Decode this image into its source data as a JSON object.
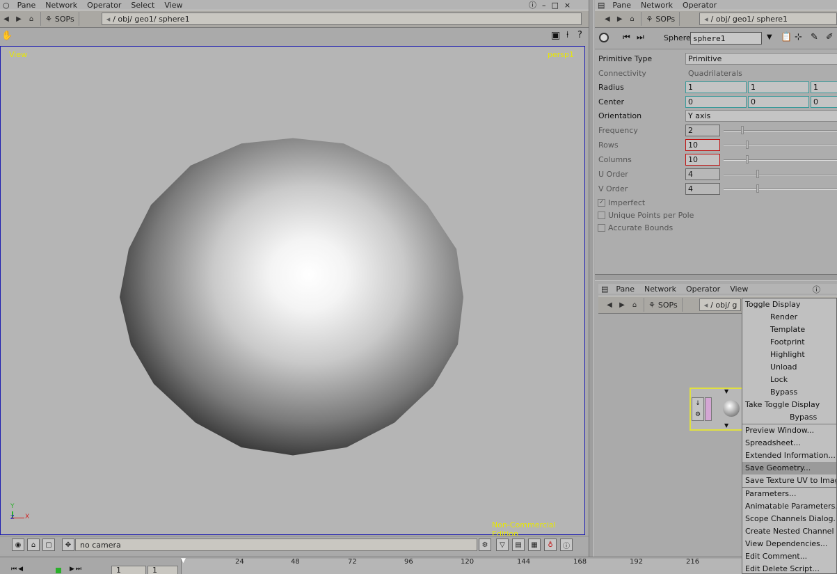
{
  "left_pane": {
    "menu": [
      "Pane",
      "Network",
      "Operator",
      "Select",
      "View"
    ],
    "context": "SOPs",
    "path": "/ obj/ geo1/ sphere1",
    "viewport_label": "View",
    "camera_label": "persp1",
    "watermark": "Non-Commercial Edition",
    "axis_y": "Y",
    "axis_z": "Z",
    "axis_x": "X",
    "camera_field": "no camera"
  },
  "param_pane": {
    "menu": [
      "Pane",
      "Network",
      "Operator"
    ],
    "context": "SOPs",
    "path": "/ obj/ geo1/ sphere1",
    "op_type": "Sphere",
    "op_name": "sphere1",
    "params": {
      "primitive_type": {
        "label": "Primitive Type",
        "value": "Primitive"
      },
      "connectivity": {
        "label": "Connectivity",
        "value": "Quadrilaterals"
      },
      "radius": {
        "label": "Radius",
        "values": [
          "1",
          "1",
          "1"
        ]
      },
      "center": {
        "label": "Center",
        "values": [
          "0",
          "0",
          "0"
        ]
      },
      "orientation": {
        "label": "Orientation",
        "value": "Y axis"
      },
      "frequency": {
        "label": "Frequency",
        "value": "2"
      },
      "rows": {
        "label": "Rows",
        "value": "10"
      },
      "columns": {
        "label": "Columns",
        "value": "10"
      },
      "u_order": {
        "label": "U Order",
        "value": "4"
      },
      "v_order": {
        "label": "V Order",
        "value": "4"
      }
    },
    "toggles": [
      {
        "label": "Imperfect",
        "checked": true
      },
      {
        "label": "Unique Points per Pole",
        "checked": false
      },
      {
        "label": "Accurate Bounds",
        "checked": false
      }
    ]
  },
  "network_pane": {
    "menu": [
      "Pane",
      "Network",
      "Operator",
      "View"
    ],
    "context": "SOPs",
    "path": "/ obj/ g"
  },
  "context_menu": {
    "items": [
      {
        "label": "Toggle Display",
        "level": 0
      },
      {
        "label": "Render",
        "level": 1
      },
      {
        "label": "Template",
        "level": 1
      },
      {
        "label": "Footprint",
        "level": 1
      },
      {
        "label": "Highlight",
        "level": 1
      },
      {
        "label": "Unload",
        "level": 1
      },
      {
        "label": "Lock",
        "level": 1
      },
      {
        "label": "Bypass",
        "level": 1
      },
      {
        "label": "Take Toggle Display",
        "level": 0
      },
      {
        "label": "Bypass",
        "level": 2
      },
      {
        "label": "Preview Window...",
        "level": 0
      },
      {
        "label": "Spreadsheet...",
        "level": 0
      },
      {
        "label": "Extended Information...",
        "level": 0
      },
      {
        "label": "Save Geometry...",
        "level": 0,
        "highlight": true
      },
      {
        "label": "Save Texture UV to Image",
        "level": 0
      },
      {
        "label": "Parameters...",
        "level": 0
      },
      {
        "label": "Animatable Parameters...",
        "level": 0
      },
      {
        "label": "Scope Channels Dialog...",
        "level": 0
      },
      {
        "label": "Create Nested Channel Gro",
        "level": 0
      },
      {
        "label": "View Dependencies...",
        "level": 0
      },
      {
        "label": "Edit Comment...",
        "level": 0
      },
      {
        "label": "Edit Delete Script...",
        "level": 0
      }
    ]
  },
  "timeline": {
    "frame_start": "1",
    "frame_cur": "1",
    "ticks": [
      "24",
      "48",
      "72",
      "96",
      "120",
      "144",
      "168",
      "192",
      "216"
    ]
  },
  "colors": {
    "viewport_border": "#1a1ab0",
    "label_yellow": "#e8e800",
    "node_highlight": "#e0e040",
    "field_red": "#c01010",
    "field_teal": "#3a9a9a"
  }
}
